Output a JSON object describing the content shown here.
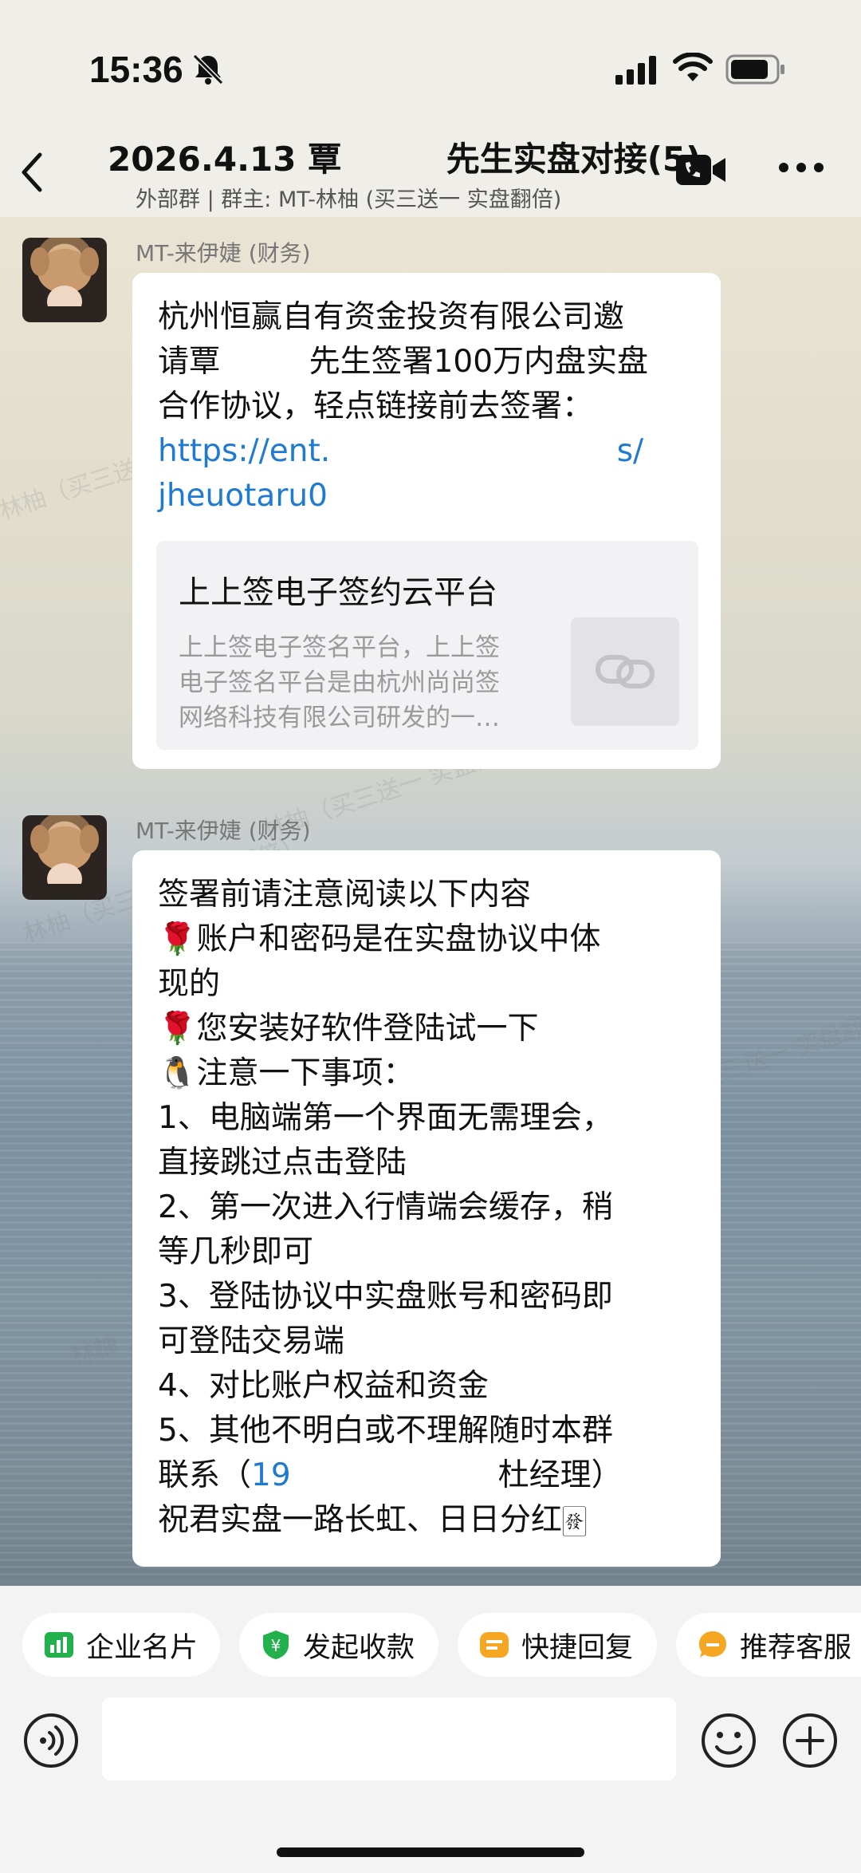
{
  "status_bar": {
    "time": "15:36"
  },
  "header": {
    "title": "2026.4.13 覃         先生实盘对接(5)",
    "subtitle": "外部群 | 群主: MT-林柚 (买三送一 实盘翻倍)"
  },
  "messages": [
    {
      "sender": "MT-来伊婕 (财务)",
      "lines": [
        "杭州恒赢自有资金投资有限公司邀",
        "请覃         先生签署100万内盘实盘",
        "合作协议，轻点链接前去签署："
      ],
      "link_lines": [
        "https://ent.                             s/",
        "jheuotaru0"
      ],
      "card": {
        "title": "上上签电子签约云平台",
        "desc_lines": [
          "上上签电子签名平台，上上签",
          "电子签名平台是由杭州尚尚签",
          "网络科技有限公司研发的一…"
        ]
      }
    },
    {
      "sender": "MT-来伊婕 (财务)",
      "lines": [
        "签署前请注意阅读以下内容",
        "🌹账户和密码是在实盘协议中体",
        "现的",
        "🌹您安装好软件登陆试一下",
        "🐧注意一下事项：",
        "1、电脑端第一个界面无需理会，",
        "直接跳过点击登陆",
        "2、第一次进入行情端会缓存，稍",
        "等几秒即可",
        "3、登陆协议中实盘账号和密码即",
        "可登陆交易端",
        "4、对比账户权益和资金",
        "5、其他不明白或不理解随时本群"
      ],
      "contact_prefix": "联系（",
      "contact_phone": "19",
      "contact_suffix": "杜经理）",
      "closing": "祝君实盘一路长虹、日日分红🀅"
    }
  ],
  "watermark": "林柚（买三送一 实盘翻倍）",
  "quick_actions": [
    {
      "label": "企业名片",
      "icon": "business-card-icon",
      "color": "#22b14c"
    },
    {
      "label": "发起收款",
      "icon": "payment-icon",
      "color": "#22b14c"
    },
    {
      "label": "快捷回复",
      "icon": "quick-reply-icon",
      "color": "#f5a623"
    },
    {
      "label": "推荐客服",
      "icon": "recommend-service-icon",
      "color": "#f5a623"
    }
  ]
}
